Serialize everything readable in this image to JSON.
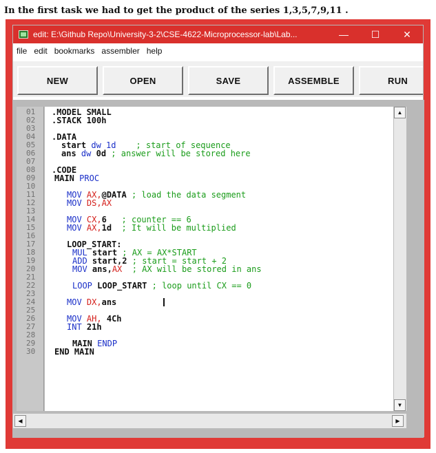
{
  "caption": "In the first task we had to get the product of the series 1,3,5,7,9,11 .",
  "window": {
    "title": "edit: E:\\Github Repo\\University-3-2\\CSE-4622-Microprocessor-lab\\Lab...",
    "minimize_glyph": "—",
    "maximize_glyph": "☐",
    "close_glyph": "✕"
  },
  "menu": [
    "file",
    "edit",
    "bookmarks",
    "assembler",
    "help"
  ],
  "toolbar": {
    "new": "NEW",
    "open": "OPEN",
    "save": "SAVE",
    "assemble": "ASSEMBLE",
    "run": "RUN"
  },
  "line_numbers": [
    "01",
    "02",
    "03",
    "04",
    "05",
    "06",
    "07",
    "08",
    "09",
    "10",
    "11",
    "12",
    "13",
    "14",
    "15",
    "16",
    "17",
    "18",
    "19",
    "20",
    "21",
    "22",
    "23",
    "24",
    "25",
    "26",
    "27",
    "28",
    "29",
    "30"
  ],
  "code": {
    "l01": ".MODEL SMALL",
    "l02": ".STACK 100h",
    "l04": ".DATA",
    "l05a": "start",
    "l05b": "dw 1d",
    "l05c": "; start of sequence",
    "l06a": "ans",
    "l06b": "dw",
    "l06c": "0d",
    "l06d": "; answer will be stored here",
    "l08": ".CODE",
    "l09a": "MAIN",
    "l09b": "PROC",
    "l11a": "MOV",
    "l11b": "AX,",
    "l11c": "@DATA",
    "l11d": "; load the data segment",
    "l12a": "MOV",
    "l12b": "DS,AX",
    "l14a": "MOV",
    "l14b": "CX,",
    "l14c": "6",
    "l14d": "; counter == 6",
    "l15a": "MOV",
    "l15b": "AX,",
    "l15c": "1d",
    "l15d": "; It will be multiplied",
    "l17": "LOOP_START:",
    "l18a": "MUL",
    "l18b": "start",
    "l18c": "; AX = AX*START",
    "l19a": "ADD",
    "l19b": "start,",
    "l19c": "2",
    "l19d": "; start = start + 2",
    "l20a": "MOV",
    "l20b": "ans,",
    "l20c": "AX",
    "l20d": "; AX will be stored in ans",
    "l22a": "LOOP",
    "l22b": "LOOP_START",
    "l22c": "; loop until CX == 0",
    "l24a": "MOV",
    "l24b": "DX,",
    "l24c": "ans",
    "l26a": "MOV",
    "l26b": "AH,",
    "l26c": "4Ch",
    "l27a": "INT",
    "l27b": "21h",
    "l29a": "MAIN",
    "l29b": "ENDP",
    "l30": "END MAIN"
  },
  "scroll": {
    "up": "▲",
    "down": "▼",
    "left": "◀",
    "right": "▶"
  }
}
